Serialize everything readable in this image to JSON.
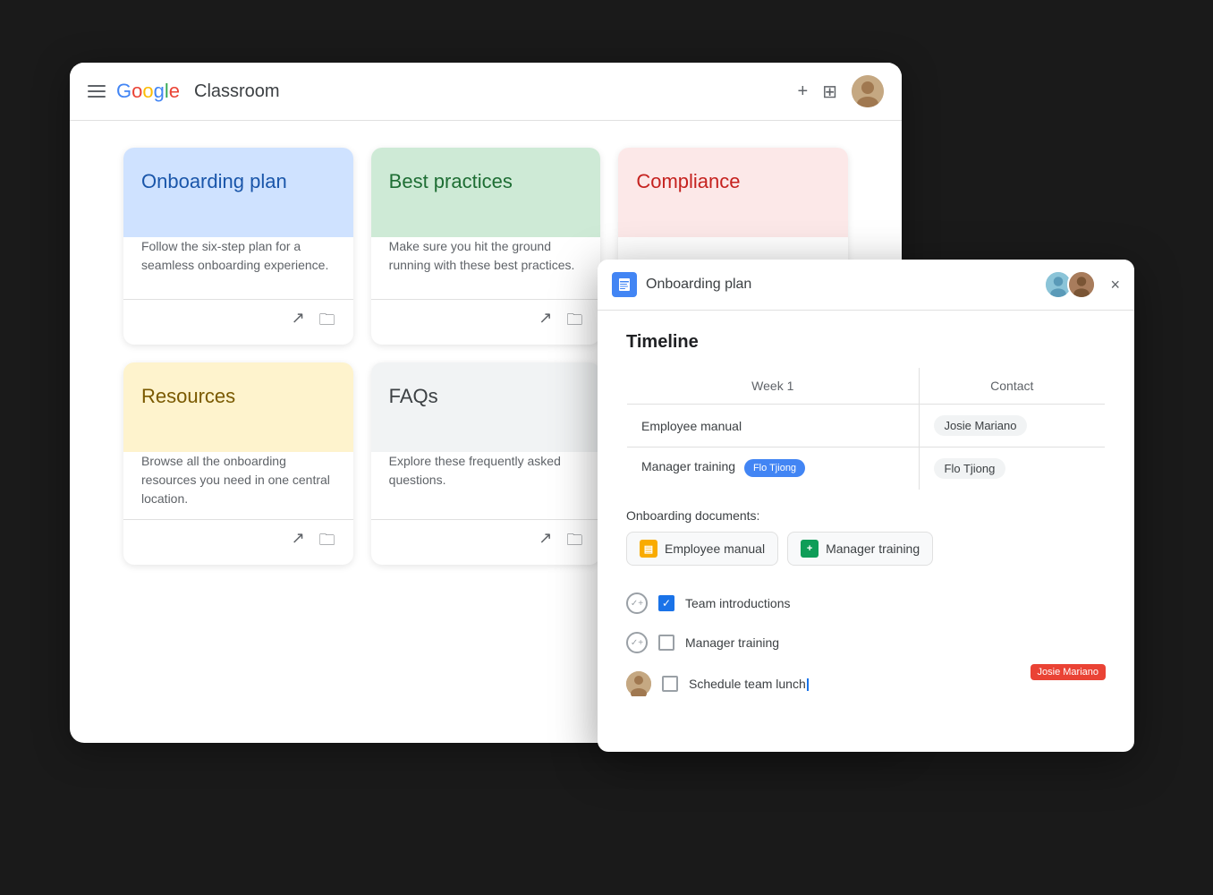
{
  "classroom": {
    "header": {
      "app_name": "Google",
      "app_sub": "Classroom",
      "plus_label": "+",
      "grid_label": "⊞"
    },
    "cards": [
      {
        "id": "onboarding-plan",
        "title": "Onboarding plan",
        "desc": "Follow the six-step plan for a seamless onboarding experience.",
        "color": "blue"
      },
      {
        "id": "best-practices",
        "title": "Best practices",
        "desc": "Make sure you hit the ground running with these best practices.",
        "color": "green"
      },
      {
        "id": "compliance",
        "title": "Compliance",
        "desc": "",
        "color": "pink"
      },
      {
        "id": "resources",
        "title": "Resources",
        "desc": "Browse all the onboarding resources you need in one central location.",
        "color": "yellow"
      },
      {
        "id": "faqs",
        "title": "FAQs",
        "desc": "Explore these frequently asked questions.",
        "color": "gray"
      }
    ]
  },
  "doc": {
    "title": "Onboarding plan",
    "close_label": "×",
    "timeline_section": "Timeline",
    "table": {
      "headers": [
        "Week 1",
        "Contact"
      ],
      "rows": [
        {
          "item": "Employee manual",
          "contact": "Josie Mariano",
          "tag": null
        },
        {
          "item": "Manager training",
          "contact": "Flo Tjiong",
          "tag": "Flo Tjiong"
        }
      ]
    },
    "onboarding_docs_label": "Onboarding documents:",
    "docs": [
      {
        "name": "Employee manual",
        "icon_type": "yellow",
        "icon_label": "▤"
      },
      {
        "name": "Manager training",
        "icon_type": "green",
        "icon_label": "+"
      }
    ],
    "checklist": [
      {
        "id": "team-intro",
        "text": "Team introductions",
        "checked": true,
        "has_avatar": false,
        "badge": null
      },
      {
        "id": "manager-training",
        "text": "Manager training",
        "checked": false,
        "has_avatar": false,
        "badge": null
      },
      {
        "id": "schedule-lunch",
        "text": "Schedule team lunch",
        "checked": false,
        "has_avatar": true,
        "badge": "Josie Mariano",
        "cursor": true
      }
    ]
  }
}
